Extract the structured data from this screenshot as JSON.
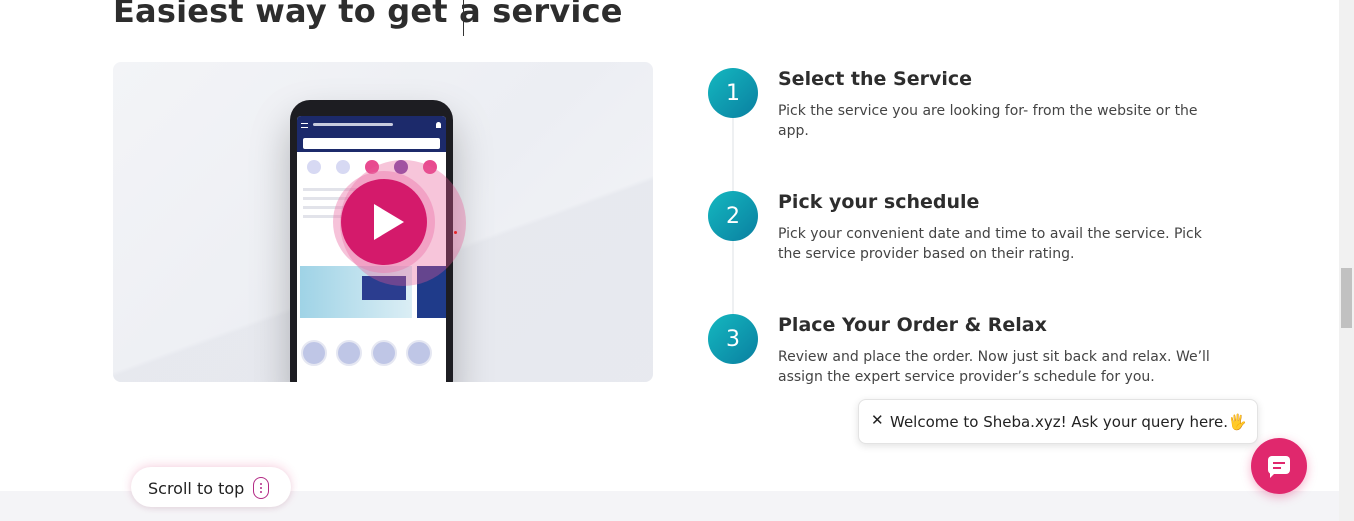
{
  "section": {
    "heading": "Easiest way to get a service"
  },
  "video": {
    "play_icon": "play-icon"
  },
  "steps": [
    {
      "number": "1",
      "title": "Select the Service",
      "description": "Pick the service you are looking for- from the website or the app."
    },
    {
      "number": "2",
      "title": "Pick your schedule",
      "description": "Pick your convenient date and time to avail the service. Pick the service provider based on their rating."
    },
    {
      "number": "3",
      "title": "Place Your Order & Relax",
      "description": "Review and place the order. Now just sit back and relax. We’ll assign the expert service provider’s schedule for you."
    }
  ],
  "chat": {
    "close_icon": "close-icon",
    "message": "Welcome to Sheba.xyz! Ask your query here.🖐",
    "fab_icon": "chat-icon"
  },
  "scroll_top": {
    "label": "Scroll to top",
    "icon": "scroll-icon"
  },
  "colors": {
    "accent": "#e0286d",
    "step_teal": "#0a8fa8",
    "footer": "#f4f4f7"
  }
}
